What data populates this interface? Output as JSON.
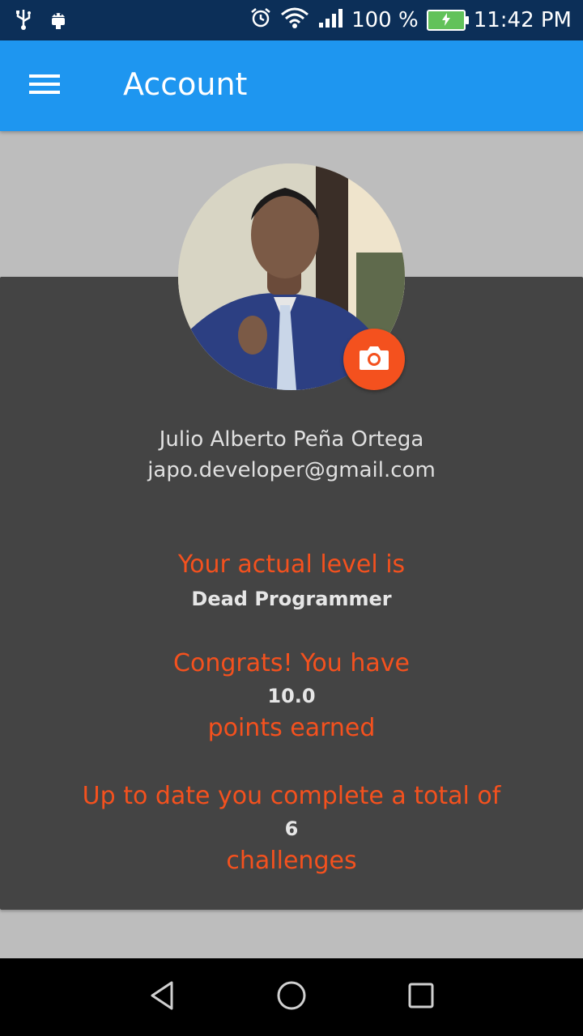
{
  "status_bar": {
    "battery_percent": "100 %",
    "time": "11:42 PM",
    "icons": [
      "usb-icon",
      "android-debug-icon",
      "alarm-icon",
      "wifi-icon",
      "signal-icon",
      "battery-icon"
    ]
  },
  "app_bar": {
    "title": "Account",
    "menu_icon": "hamburger-menu-icon"
  },
  "profile": {
    "name": "Julio Alberto Peña Ortega",
    "email": "japo.developer@gmail.com",
    "camera_icon": "camera-icon"
  },
  "stats": {
    "level_intro": "Your actual level is",
    "level_value": "Dead Programmer",
    "points_intro": "Congrats! You have",
    "points_value": "10.0",
    "points_suffix": "points earned",
    "challenges_intro": "Up to date you complete a total of",
    "challenges_value": "6",
    "challenges_suffix": "challenges"
  },
  "colors": {
    "app_bar": "#1e96f0",
    "status_bar": "#0c2f58",
    "card": "#444444",
    "accent": "#f4511e",
    "background": "#bdbdbd"
  },
  "nav": {
    "back_icon": "back-triangle-icon",
    "home_icon": "home-circle-icon",
    "recents_icon": "recents-square-icon"
  }
}
